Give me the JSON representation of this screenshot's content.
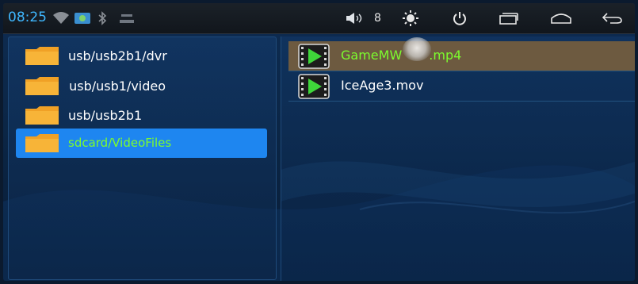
{
  "status_bar": {
    "time": "08:25",
    "volume_level": "8",
    "icons": [
      "wifi-icon",
      "gallery-icon",
      "bluetooth-icon",
      "usb-icon",
      "volume-icon",
      "brightness-icon",
      "power-icon",
      "recent-apps-icon",
      "home-icon",
      "back-icon"
    ]
  },
  "folders": [
    {
      "label": "usb/usb2b1/dvr",
      "selected": false
    },
    {
      "label": " usb/usb1/video",
      "selected": false
    },
    {
      "label": "usb/usb2b1",
      "selected": false
    },
    {
      "label": "sdcard/VideoFiles",
      "selected": true
    }
  ],
  "files": [
    {
      "label": "GameMW",
      "label_tail": ".mp4",
      "selected": true
    },
    {
      "label": "IceAge3.mov",
      "selected": false
    }
  ],
  "colors": {
    "accent": "#3fb8ff",
    "selected_folder_bg": "#1e86f0",
    "selected_text": "#7cfc2e",
    "selected_file_bg": "#6d5a40"
  }
}
